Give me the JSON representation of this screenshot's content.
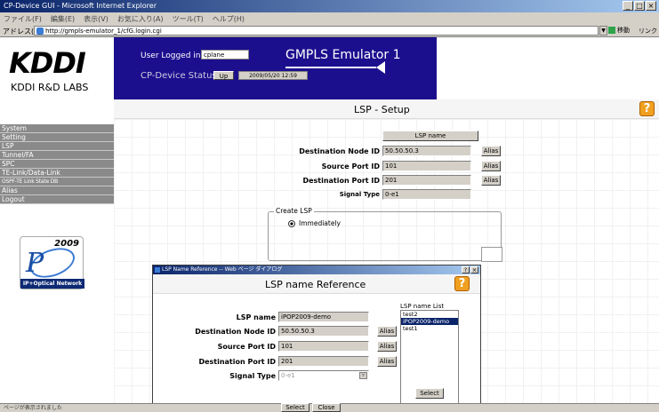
{
  "window": {
    "title": "CP-Device GUI - Microsoft Internet Explorer",
    "controls": [
      "_",
      "□",
      "×"
    ]
  },
  "menu": [
    "ファイル(F)",
    "編集(E)",
    "表示(V)",
    "お気に入り(A)",
    "ツール(T)",
    "ヘルプ(H)"
  ],
  "address": {
    "label": "アドレス(D)",
    "url": "http://gmpls-emulator_1/cfG.login.cgi",
    "go": "移動",
    "links": "リンク"
  },
  "logo": {
    "kddi": "KDDI",
    "labs": "KDDI R&D LABS"
  },
  "header": {
    "user_label": "User Logged in:",
    "user_value": "cplane",
    "device_label": "CP-Device Status",
    "device_status": "Up",
    "device_time": "2009/05/20 12:59",
    "title": "GMPLS Emulator 1"
  },
  "page_title": "LSP - Setup",
  "nav": [
    "System",
    "Setting",
    "LSP",
    "Tunnel/FA",
    "SPC",
    "TE-Link/Data-Link",
    "OSPF-TE Link State DB",
    "Alias",
    "Logout"
  ],
  "pop_logo": {
    "year": "2009",
    "caption": "IP+Optical Network"
  },
  "lsp_form": {
    "lsp_name_button": "LSP name",
    "dest_label": "Destination Node ID",
    "dest_value": "50.50.50.3",
    "src_label": "Source Port ID",
    "src_value": "101",
    "dstport_label": "Destination Port ID",
    "dstport_value": "201",
    "signal_label": "Signal Type",
    "signal_value": "0-e1",
    "alias": "Alias"
  },
  "create": {
    "legend": "Create LSP",
    "option": "Immediately"
  },
  "popup": {
    "title": "LSP Name Reference -- Web ページ ダイアログ",
    "controls": [
      "?",
      "×"
    ],
    "heading": "LSP name Reference",
    "lsp_name_label": "LSP name",
    "lsp_name_value": "iPOP2009-demo",
    "dest_label": "Destination Node ID",
    "dest_value": "50.50.50.3",
    "src_label": "Source Port ID",
    "src_value": "101",
    "dstport_label": "Destination Port ID",
    "dstport_value": "201",
    "signal_label": "Signal Type",
    "signal_value": "0-e1",
    "alias": "Alias",
    "list_label": "LSP name List",
    "list_items": [
      "test2",
      "iPOP2009-demo",
      "test1"
    ],
    "select_button": "Select",
    "bottom_select": "Select",
    "bottom_close": "Close"
  },
  "status": "ページが表示されました"
}
